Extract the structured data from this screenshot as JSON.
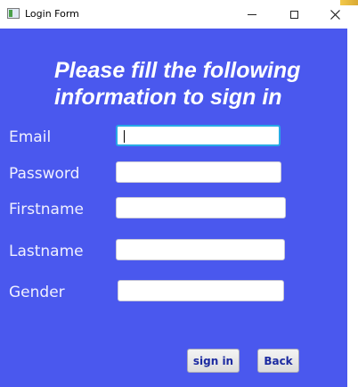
{
  "window": {
    "title": "Login Form",
    "icon": "window-app-icon"
  },
  "form": {
    "heading_line1": "Please fill the following",
    "heading_line2": "information to sign in",
    "fields": {
      "email": {
        "label": "Email",
        "value": ""
      },
      "password": {
        "label": "Password",
        "value": ""
      },
      "firstname": {
        "label": "Firstname",
        "value": ""
      },
      "lastname": {
        "label": "Lastname",
        "value": ""
      },
      "gender": {
        "label": "Gender",
        "value": ""
      }
    },
    "signin_label": "sign in",
    "back_label": "Back"
  },
  "colors": {
    "background": "#4a58ee",
    "focus_border": "#27a9e6",
    "button_text": "#1c2aa0"
  }
}
